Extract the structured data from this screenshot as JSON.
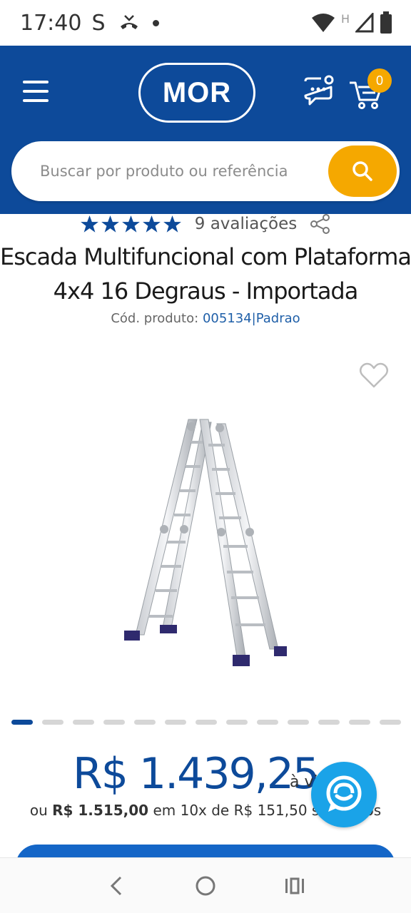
{
  "status_bar": {
    "time": "17:40",
    "carrier_letter": "S",
    "network_letter": "H"
  },
  "header": {
    "logo_text": "MOR",
    "cart_count": "0",
    "search": {
      "placeholder": "Buscar por produto ou referência"
    }
  },
  "product": {
    "rating_stars": 5,
    "reviews_label": "9 avaliações",
    "title_line1": "Escada Multifuncional com Plataforma",
    "title_line2": "4x4 16 Degraus - Importada",
    "code_label": "Cód. produto:",
    "code_value": "005134|Padrao",
    "image_alt": "Escada Multifuncional com Plataforma",
    "carousel": {
      "total_slides": 13,
      "active_index": 0
    },
    "price": {
      "main": "R$ 1.439,25",
      "cash_suffix": "à vista",
      "installments_prefix": "ou",
      "installments_total": "R$ 1.515,00",
      "installments_text": "em 10x de R$ 151,50 sem juros"
    }
  },
  "colors": {
    "brand_blue": "#0d4a9a",
    "accent_yellow": "#f5a800",
    "chat_blue": "#1aa3e8"
  }
}
